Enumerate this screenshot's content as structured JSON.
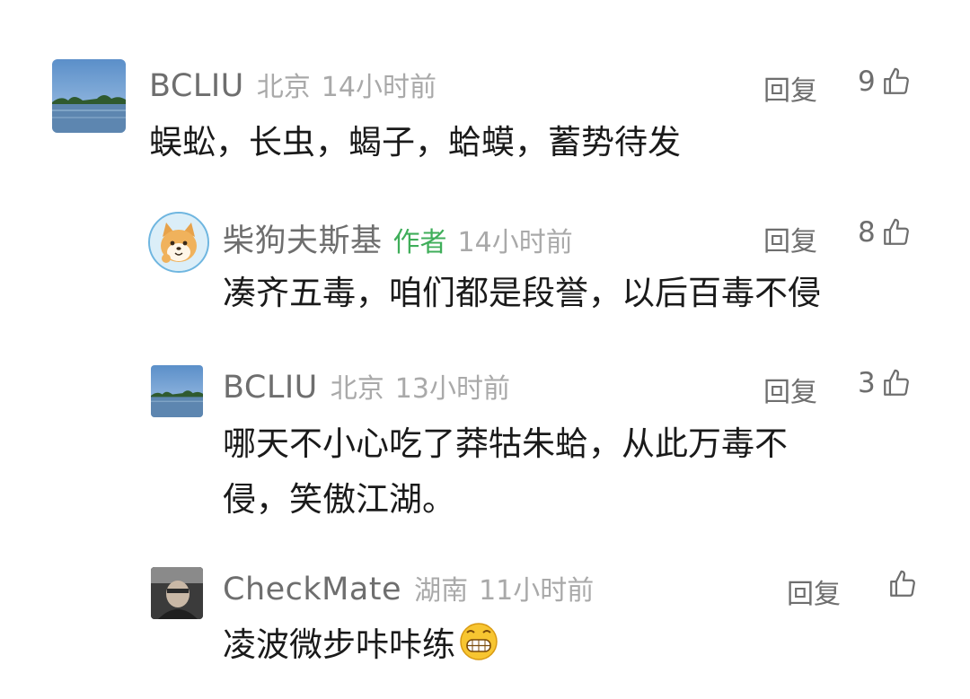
{
  "comments": [
    {
      "user": "BCLIU",
      "location": "北京",
      "time": "14小时前",
      "reply": "回复",
      "likes": "9",
      "text": "蜈蚣，长虫，蝎子，蛤蟆，蓄势待发"
    },
    {
      "user": "柴狗夫斯基",
      "author_tag": "作者",
      "time": "14小时前",
      "reply": "回复",
      "likes": "8",
      "text": "凑齐五毒，咱们都是段誉，以后百毒不侵"
    },
    {
      "user": "BCLIU",
      "location": "北京",
      "time": "13小时前",
      "reply": "回复",
      "likes": "3",
      "text_line1": "哪天不小心吃了莽牯朱蛤，从此万毒不",
      "text_line2": "侵，笑傲江湖。"
    },
    {
      "user": "CheckMate",
      "location": "湖南",
      "time": "11小时前",
      "reply": "回复",
      "likes": "",
      "text": "凌波微步咔咔练",
      "emoji": "grinning-face-emoji"
    }
  ],
  "colors": {
    "name": "#6e6e6e",
    "meta": "#a9a9a9",
    "author_tag": "#3fae5a",
    "text": "#1a1a1a"
  },
  "icons": {
    "like": "thumbs-up-icon"
  }
}
